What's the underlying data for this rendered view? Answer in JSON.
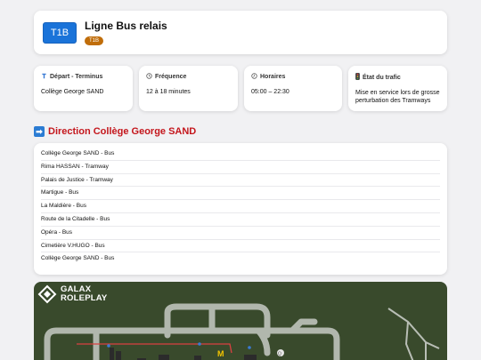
{
  "header": {
    "line_code": "T1B",
    "title": "Ligne Bus relais",
    "pill": "T1B"
  },
  "info": [
    {
      "icon": "terminus-icon",
      "title": "Départ - Terminus",
      "value": "Collège George SAND"
    },
    {
      "icon": "clock-icon",
      "title": "Fréquence",
      "value": "12 à 18 minutes"
    },
    {
      "icon": "time-icon",
      "title": "Horaires",
      "value": "05:00 – 22:30"
    },
    {
      "icon": "traffic-light-icon",
      "title": "État du trafic",
      "value": "Mise en service lors de grosse perturbation des Tramways"
    }
  ],
  "direction": {
    "arrow": "➡",
    "label": "Direction Collège George SAND"
  },
  "stops": [
    "Collège George SAND - Bus",
    "Rima HASSAN - Tramway",
    "Palais de Justice - Tramway",
    "Martigue - Bus",
    "La Maldière - Bus",
    "Route de la Citadelle - Bus",
    "Opéra - Bus",
    "Cimetière V.HUGO - Bus",
    "Collège George SAND - Bus"
  ],
  "map": {
    "logo_line1": "GALAX",
    "logo_line2": "ROLEPLAY"
  },
  "colors": {
    "line_badge": "#1a73d9",
    "pill": "#c06d0a",
    "direction": "#c4161c",
    "map_bg": "#394a2c"
  }
}
